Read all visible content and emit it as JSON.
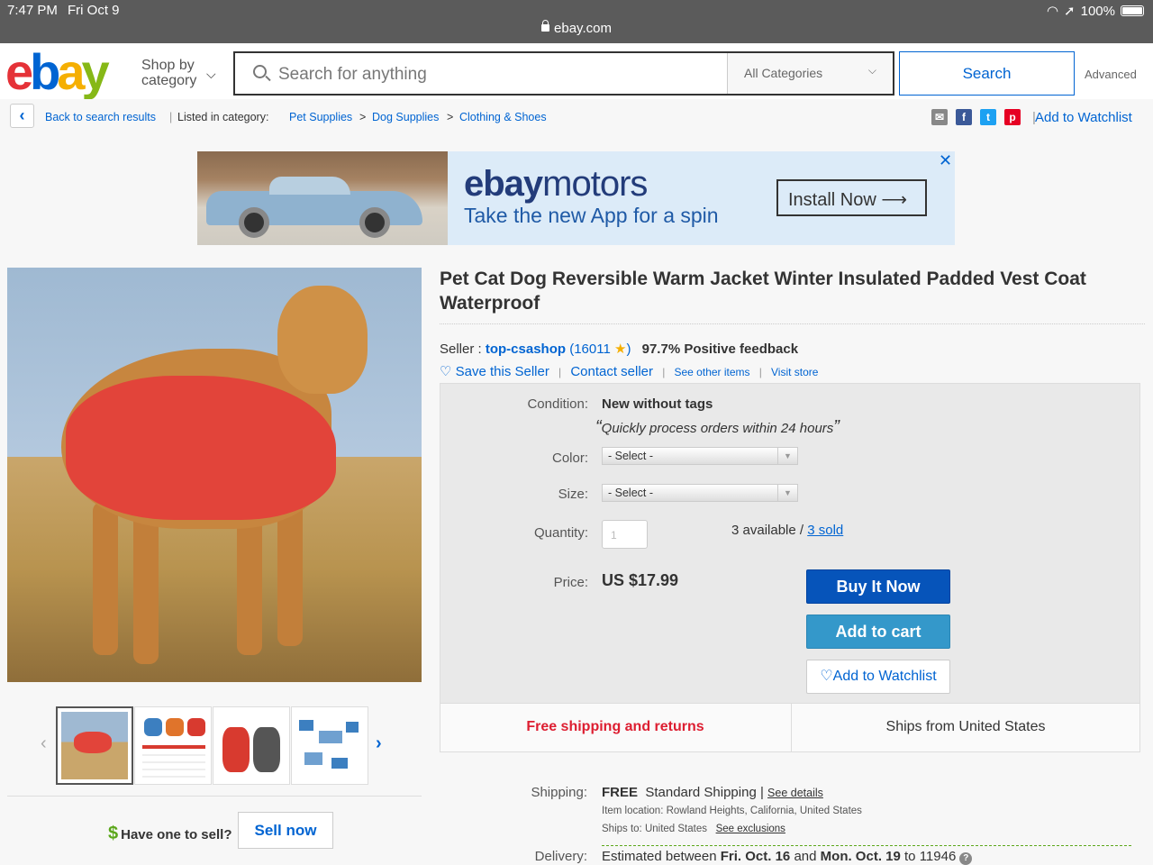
{
  "status": {
    "time": "7:47 PM",
    "date": "Fri Oct 9",
    "url": "ebay.com",
    "battery": "100%"
  },
  "header": {
    "shop_by_line1": "Shop by",
    "shop_by_line2": "category",
    "search_placeholder": "Search for anything",
    "category": "All Categories",
    "search_button": "Search",
    "advanced": "Advanced"
  },
  "breadcrumb": {
    "back": "Back to search results",
    "listed_in": "Listed in category:",
    "items": [
      "Pet Supplies",
      "Dog Supplies",
      "Clothing & Shoes"
    ],
    "separator": ">",
    "watchlist": "Add to Watchlist"
  },
  "ad": {
    "brand_bold": "ebay",
    "brand_regular": "motors",
    "tagline": "Take the new App for a spin",
    "install": "Install Now",
    "close": "✕"
  },
  "product": {
    "title": "Pet Cat Dog Reversible Warm Jacket Winter Insulated Padded Vest Coat Waterproof",
    "seller_label": "Seller :",
    "seller_name": "top-csashop",
    "seller_score": "16011",
    "feedback": "97.7% Positive feedback",
    "save_seller": "Save this Seller",
    "contact_seller": "Contact seller",
    "see_other_items": "See other items",
    "visit_store": "Visit store"
  },
  "offer": {
    "condition_label": "Condition:",
    "condition": "New without tags",
    "quote": "Quickly process orders within 24 hours",
    "color_label": "Color:",
    "color_value": "- Select -",
    "size_label": "Size:",
    "size_value": "- Select -",
    "quantity_label": "Quantity:",
    "quantity_value": "1",
    "available": "3 available /",
    "sold": "3 sold",
    "price_label": "Price:",
    "price": "US $17.99",
    "buy_now": "Buy It Now",
    "add_to_cart": "Add to cart",
    "add_to_watchlist": "Add to Watchlist",
    "free_shipping": "Free shipping and returns",
    "ships_from": "Ships from United States"
  },
  "shipping": {
    "shipping_label": "Shipping:",
    "free": "FREE",
    "method": "Standard Shipping |",
    "see_details": "See details",
    "item_location": "Item location:  Rowland Heights, California, United States",
    "ships_to": "Ships to:  United States",
    "see_exclusions": "See exclusions",
    "delivery_label": "Delivery:",
    "delivery_prefix": "Estimated between",
    "delivery_from": "Fri. Oct. 16",
    "delivery_and": "and",
    "delivery_to": "Mon. Oct. 19",
    "delivery_zip": "to 11946"
  },
  "sell": {
    "prompt": "Have one to sell?",
    "button": "Sell now"
  },
  "colors": {
    "ebay_red": "#e53238",
    "ebay_blue": "#0064d2",
    "ebay_yellow": "#f5af02",
    "ebay_green": "#86b817",
    "buy_now": "#0654ba",
    "cart": "#3498ca"
  }
}
